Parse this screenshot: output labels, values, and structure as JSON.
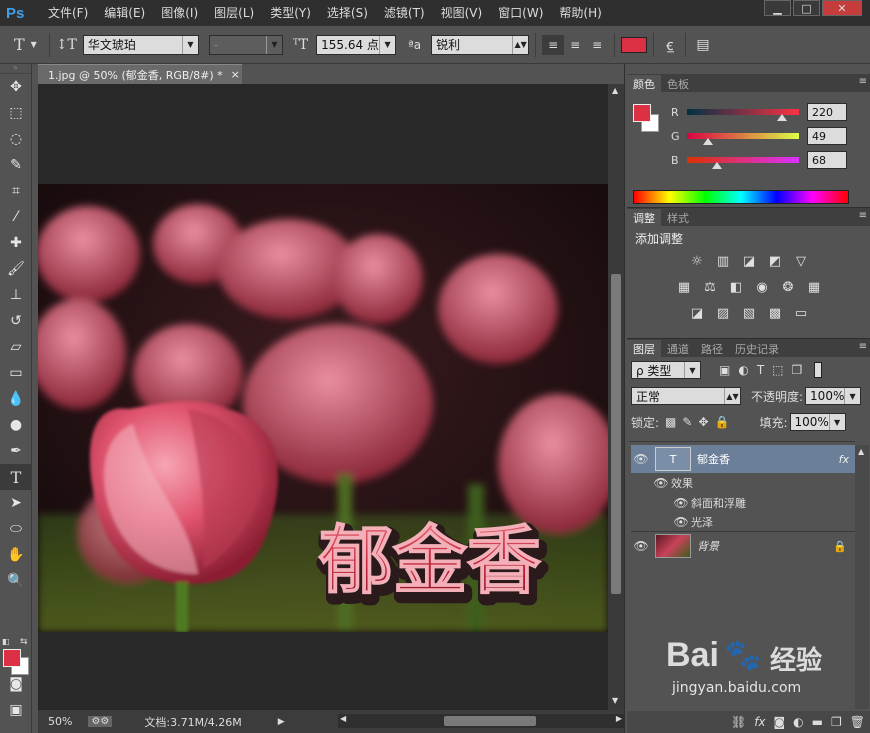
{
  "app": {
    "logo": "Ps"
  },
  "menu": [
    "文件(F)",
    "编辑(E)",
    "图像(I)",
    "图层(L)",
    "类型(Y)",
    "选择(S)",
    "滤镜(T)",
    "视图(V)",
    "窗口(W)",
    "帮助(H)"
  ],
  "window_buttons": {
    "minimize": "▁",
    "restore": "□",
    "close": "✕"
  },
  "options": {
    "font_family": "华文琥珀",
    "font_style": "-",
    "font_size": "155.64 点",
    "aa_label": "ªa",
    "antialias": "锐利",
    "text_color": "#dc3144"
  },
  "document": {
    "tab_title": "1.jpg @ 50% (郁金香, RGB/8#) *",
    "close": "×",
    "overlay_text": "郁金香"
  },
  "status": {
    "zoom": "50%",
    "doc_size": "文档:3.71M/4.26M"
  },
  "color_panel": {
    "tabs": [
      "颜色",
      "色板"
    ],
    "r": {
      "label": "R",
      "value": "220"
    },
    "g": {
      "label": "G",
      "value": "49"
    },
    "b": {
      "label": "B",
      "value": "68"
    },
    "foreground": "#dc3144"
  },
  "adjust_panel": {
    "tabs": [
      "调整",
      "样式"
    ],
    "title": "添加调整"
  },
  "layers_panel": {
    "tabs": [
      "图层",
      "通道",
      "路径",
      "历史记录"
    ],
    "filter": "ρ 类型",
    "blend_mode": "正常",
    "opacity_label": "不透明度:",
    "opacity": "100%",
    "lock_label": "锁定:",
    "fill_label": "填充:",
    "fill": "100%",
    "layers": [
      {
        "name": "郁金香",
        "type": "text",
        "fx": "fx"
      },
      {
        "name": "效果",
        "type": "effects"
      },
      {
        "name": "斜面和浮雕",
        "type": "effect"
      },
      {
        "name": "光泽",
        "type": "effect"
      },
      {
        "name": "背景",
        "type": "image",
        "locked": true
      }
    ]
  },
  "watermark": {
    "brand": "Bai",
    "brand2": "经验",
    "url": "jingyan.baidu.com"
  }
}
